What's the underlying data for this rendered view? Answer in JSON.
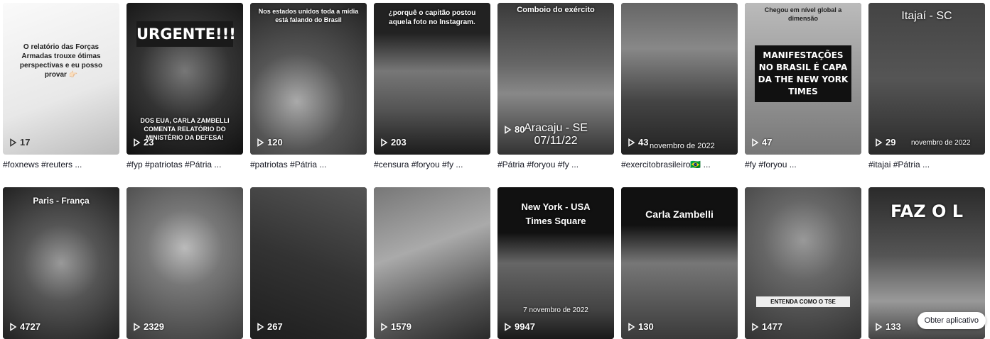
{
  "row1": [
    {
      "views": "17",
      "caption": "#foxnews #reuters ...",
      "overlay": "O relatório das Forças Armadas trouxe ótimas perspectivas e eu posso provar 👉🏻",
      "style": "light"
    },
    {
      "views": "23",
      "caption": "#fyp #patriotas #Pátria ...",
      "overlay_top": "URGENTE!!!",
      "overlay_bottom": "DOS EUA, CARLA ZAMBELLI COMENTA RELATÓRIO DO MINISTÉRIO DA DEFESA!",
      "style": "red"
    },
    {
      "views": "120",
      "caption": "#patriotas #Pátria ...",
      "overlay": "Nos estados unidos toda a mídia está falando do Brasil",
      "style": "dark"
    },
    {
      "views": "203",
      "caption": "#censura #foryou #fy ...",
      "overlay": "¿porquê o capitão postou aquela foto no Instagram.",
      "style": "dark"
    },
    {
      "views": "80",
      "caption": "#Pátria #foryou #fy ...",
      "overlay_top": "Comboio do exército",
      "overlay_bottom": "Aracaju - SE 07/11/22",
      "style": "dark"
    },
    {
      "views": "43",
      "caption": "#exercitobrasileiro🇧🇷 ...",
      "overlay": "novembro de 2022",
      "style": "dark"
    },
    {
      "views": "47",
      "caption": "#fy #foryou ...",
      "overlay_top": "Chegou em nível global a dimensão",
      "overlay_bottom": "MANIFESTAÇÕES NO BRASIL É CAPA DA THE NEW YORK TIMES",
      "style": "mid"
    },
    {
      "views": "29",
      "caption": "#itajai #Pátria ...",
      "overlay_top": "Itajaí - SC",
      "overlay_bottom": "novembro de 2022",
      "style": "dark"
    }
  ],
  "row2": [
    {
      "views": "4727",
      "overlay": "Paris - França",
      "style": "dark"
    },
    {
      "views": "2329",
      "overlay": "",
      "style": "mid"
    },
    {
      "views": "267",
      "overlay": "",
      "style": "dark"
    },
    {
      "views": "1579",
      "overlay": "",
      "style": "mid"
    },
    {
      "views": "9947",
      "overlay_top": "New York - USA Times Square",
      "overlay_bottom": "7 novembro de 2022",
      "style": "dark"
    },
    {
      "views": "130",
      "overlay_top": "Carla Zambelli",
      "overlay_bottom": "",
      "style": "dark"
    },
    {
      "views": "1477",
      "overlay": "ENTENDA COMO O TSE",
      "style": "mid"
    },
    {
      "views": "133",
      "overlay": "FAZ O L",
      "style": "dark"
    }
  ],
  "app_button": "Obter aplicativo"
}
